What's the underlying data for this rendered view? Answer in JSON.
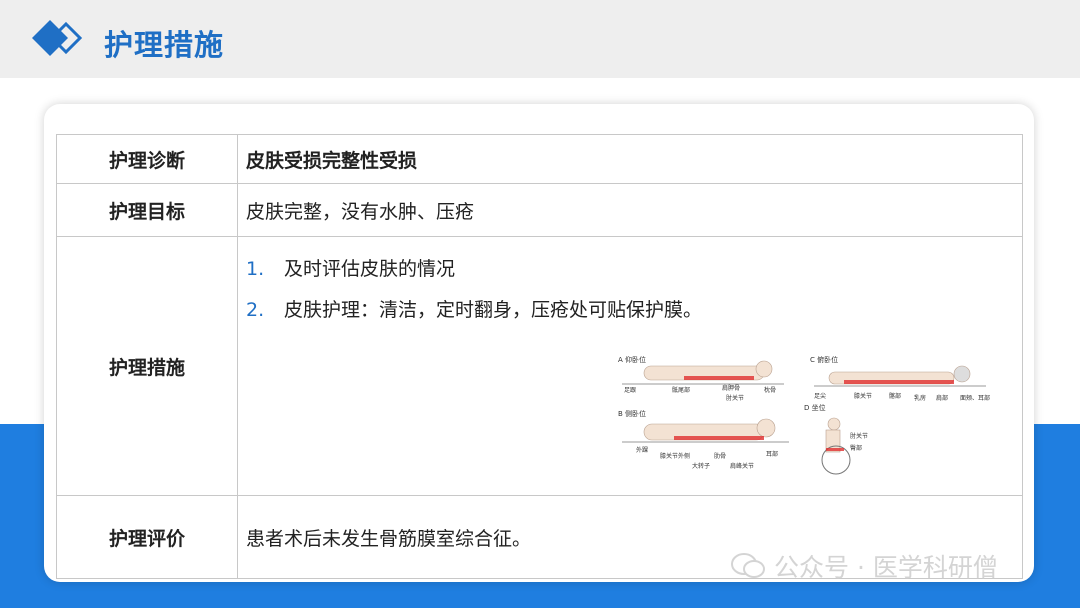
{
  "header": {
    "title": "护理措施",
    "logo_icon": "double-diamond-icon"
  },
  "table": {
    "rows": [
      {
        "label": "护理诊断",
        "value": "皮肤受损完整性受损"
      },
      {
        "label": "护理目标",
        "value": "皮肤完整，没有水肿、压疮"
      },
      {
        "label": "护理措施",
        "items": [
          {
            "num": "1.",
            "text": "及时评估皮肤的情况"
          },
          {
            "num": "2.",
            "text": "皮肤护理：清洁，定时翻身，压疮处可贴保护膜。"
          }
        ]
      },
      {
        "label": "护理评价",
        "value": "患者术后未发生骨筋膜室综合征。"
      }
    ]
  },
  "illustration": {
    "panels": [
      {
        "title": "A 仰卧位",
        "labels": [
          "足跟",
          "骶尾部",
          "肩胛骨",
          "枕骨",
          "肘关节"
        ]
      },
      {
        "title": "C 俯卧位",
        "labels": [
          "足尖",
          "膝关节",
          "髂部",
          "乳房",
          "肩部",
          "面颊、耳部"
        ]
      },
      {
        "title": "B 侧卧位",
        "labels": [
          "外踝",
          "膝关节外侧",
          "肋骨",
          "耳部",
          "大转子",
          "肩峰关节"
        ]
      },
      {
        "title": "D 坐位",
        "labels": [
          "肘关节",
          "臀部"
        ]
      }
    ]
  },
  "watermark": {
    "text": "公众号 · 医学科研僧",
    "icon": "wechat-icon"
  },
  "colors": {
    "accent": "#1f6fc5",
    "band": "#1f7ee0",
    "topbar": "#eeeeee"
  }
}
